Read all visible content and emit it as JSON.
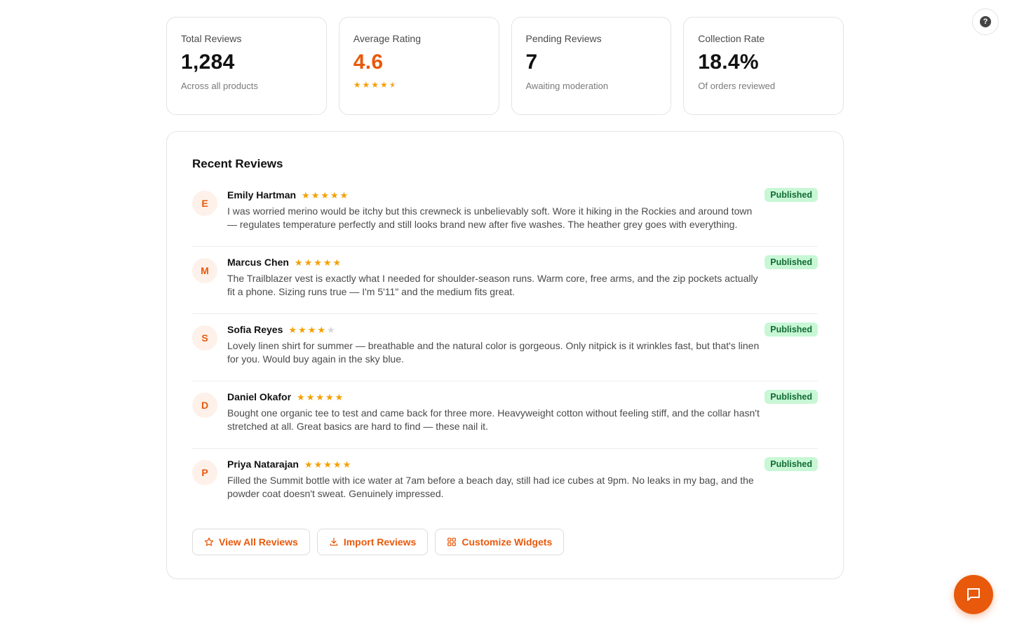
{
  "stats": [
    {
      "label": "Total Reviews",
      "value": "1,284",
      "sub": "Across all products"
    },
    {
      "label": "Average Rating",
      "value": "4.6",
      "rating": 4.6
    },
    {
      "label": "Pending Reviews",
      "value": "7",
      "sub": "Awaiting moderation"
    },
    {
      "label": "Collection Rate",
      "value": "18.4%",
      "sub": "Of orders reviewed"
    }
  ],
  "panel": {
    "title": "Recent Reviews",
    "reviews": [
      {
        "initial": "E",
        "name": "Emily Hartman",
        "rating": 5,
        "text": "I was worried merino would be itchy but this crewneck is unbelievably soft. Wore it hiking in the Rockies and around town — regulates temperature perfectly and still looks brand new after five washes. The heather grey goes with everything.",
        "status": "Published"
      },
      {
        "initial": "M",
        "name": "Marcus Chen",
        "rating": 5,
        "text": "The Trailblazer vest is exactly what I needed for shoulder-season runs. Warm core, free arms, and the zip pockets actually fit a phone. Sizing runs true — I'm 5'11\" and the medium fits great.",
        "status": "Published"
      },
      {
        "initial": "S",
        "name": "Sofia Reyes",
        "rating": 4,
        "text": "Lovely linen shirt for summer — breathable and the natural color is gorgeous. Only nitpick is it wrinkles fast, but that's linen for you. Would buy again in the sky blue.",
        "status": "Published"
      },
      {
        "initial": "D",
        "name": "Daniel Okafor",
        "rating": 5,
        "text": "Bought one organic tee to test and came back for three more. Heavyweight cotton without feeling stiff, and the collar hasn't stretched at all. Great basics are hard to find — these nail it.",
        "status": "Published"
      },
      {
        "initial": "P",
        "name": "Priya Natarajan",
        "rating": 5,
        "text": "Filled the Summit bottle with ice water at 7am before a beach day, still had ice cubes at 9pm. No leaks in my bag, and the powder coat doesn't sweat. Genuinely impressed.",
        "status": "Published"
      }
    ]
  },
  "actions": {
    "view_all": "View All Reviews",
    "import": "Import Reviews",
    "customize": "Customize Widgets"
  },
  "help": {
    "glyph": "?"
  },
  "colors": {
    "accent": "#e8590c",
    "star": "#f59f00",
    "badge_bg": "#c8f7d6",
    "badge_text": "#126b33"
  },
  "icons": {
    "help": "help-circle-icon",
    "chat": "chat-bubble-icon",
    "star": "star-outline-icon",
    "import": "download-icon",
    "widgets": "grid-icon"
  }
}
